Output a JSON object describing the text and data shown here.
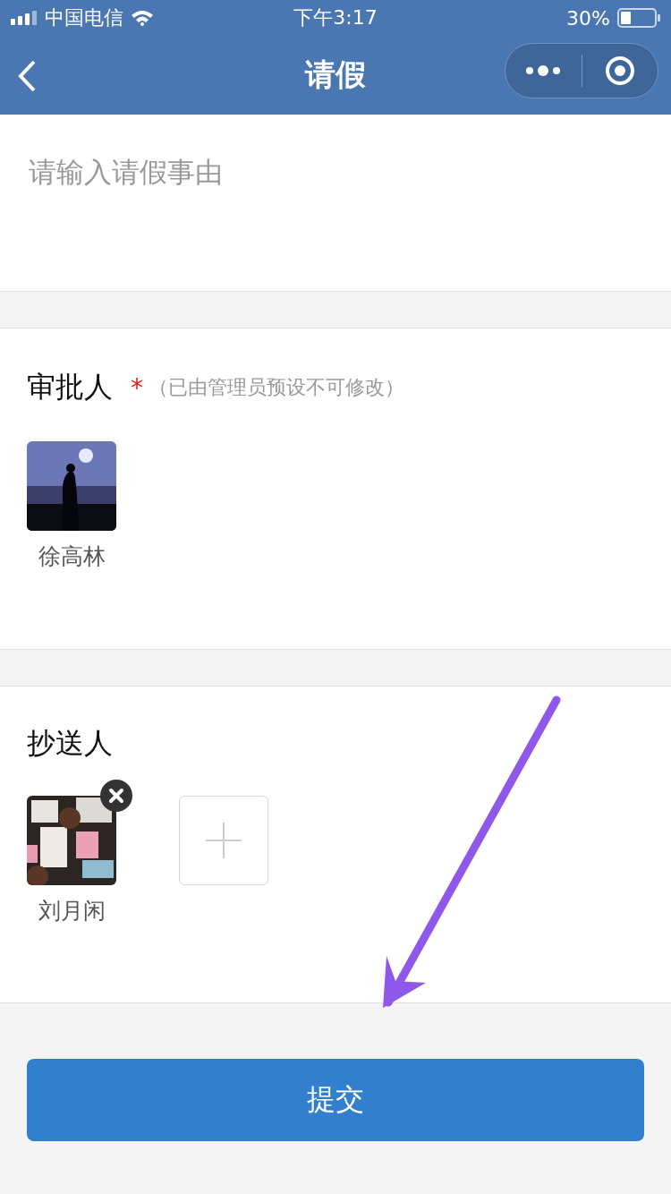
{
  "status_bar": {
    "carrier": "中国电信",
    "time": "下午3:17",
    "battery": "30%"
  },
  "nav": {
    "title": "请假"
  },
  "reason": {
    "placeholder": "请输入请假事由"
  },
  "approvers": {
    "label": "审批人",
    "required_mark": "*",
    "note": "（已由管理员预设不可修改）",
    "people": [
      {
        "name": "徐高林",
        "removable": false
      }
    ]
  },
  "cc": {
    "label": "抄送人",
    "people": [
      {
        "name": "刘月闲",
        "removable": true
      }
    ]
  },
  "submit": "提交"
}
